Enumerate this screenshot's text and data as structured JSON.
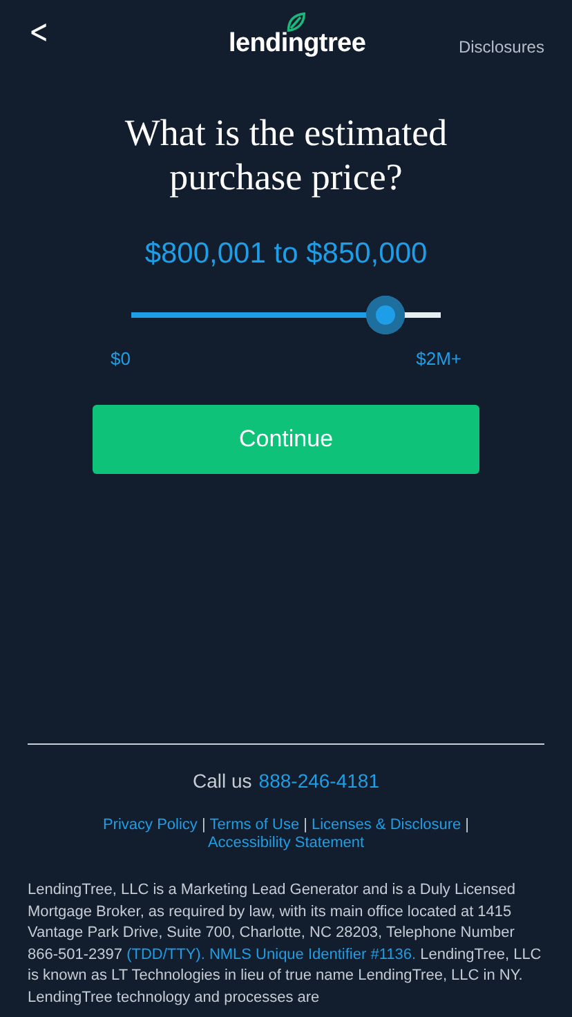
{
  "header": {
    "back": "<",
    "logo": "lendingtree",
    "disclosures": "Disclosures"
  },
  "question": "What is the estimated purchase price?",
  "price_range": "$800,001 to $850,000",
  "slider": {
    "level": 0.82,
    "min_label": "$0",
    "max_label": "$2M+"
  },
  "continue_button": "Continue",
  "footer": {
    "call_label": "Call us",
    "phone": "888-246-4181",
    "links": [
      "Privacy Policy",
      "Terms of Use",
      "Licenses & Disclosure",
      "Accessibility Statement"
    ],
    "separator": "|",
    "disclaimer": [
      {
        "kind": "text",
        "text": "LendingTree, LLC is a Marketing Lead Generator and is a Duly Licensed Mortgage Broker, as required by law, with its main office located at 1415 Vantage Park Drive, Suite 700, Charlotte, NC 28203, Telephone Number 866-501-2397 "
      },
      {
        "kind": "link",
        "text": "(TDD/TTY). NMLS Unique Identifier #1136."
      },
      {
        "kind": "text",
        "text": " LendingTree, LLC is known as LT Technologies in lieu of true name LendingTree, LLC in NY. LendingTree technology and processes are"
      }
    ]
  }
}
